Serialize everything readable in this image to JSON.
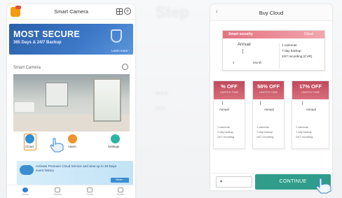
{
  "left_phone": {
    "title": "Smart Camera",
    "banner": {
      "title": "MOST SECURE",
      "subtitle": "365 Days & 24/7 Backup",
      "learn_more": "Learn more ›"
    },
    "section_label": "Smart Camera",
    "actions": [
      {
        "label": "Cloud",
        "color": "#2b8fd4"
      },
      {
        "label": "Alarm",
        "color": "#f0932b"
      },
      {
        "label": "Settings",
        "color": "#2bb3a5"
      }
    ],
    "promo": {
      "text": "Activate Premium Cloud Service and view up to 30-Days event history",
      "button": "More ›"
    },
    "nav": [
      "Home",
      "Gallery",
      "Cloud",
      "Profile"
    ]
  },
  "right_phone": {
    "title": "Buy Cloud",
    "plan": {
      "header_left": "Smart security",
      "header_right": "Cloud",
      "annual_label": "Annual",
      "month_a": "4",
      "month_b": "Month",
      "features": [
        "1 cameras",
        "7-day backup",
        "24/7 recording (CVR)"
      ]
    },
    "offers": [
      {
        "pct": "% OFF",
        "sub": "LIMITED TIME",
        "name": "Annual",
        "lines": [
          "1 cameras",
          "7-day backup",
          "24/7 recording"
        ]
      },
      {
        "pct": "58% OFF",
        "sub": "LIMITED TIME",
        "name": "Annual",
        "lines": [
          "1 cameras",
          "7-day backup",
          "24/7 recording"
        ]
      },
      {
        "pct": "17% OFF",
        "sub": "LIMITED TIME",
        "name": "Annual",
        "lines": [
          "1 cameras",
          "7-day backup",
          "24/7 recording"
        ]
      }
    ],
    "select_arrow": "▾",
    "continue_label": "CONTINUE"
  },
  "watermark": {
    "line1": "Step",
    "line2": "...",
    "line3": "..."
  },
  "colors": {
    "accent_blue": "#2b5fa8",
    "accent_teal": "#2f9d8a",
    "offer_red": "#c04a5c"
  }
}
